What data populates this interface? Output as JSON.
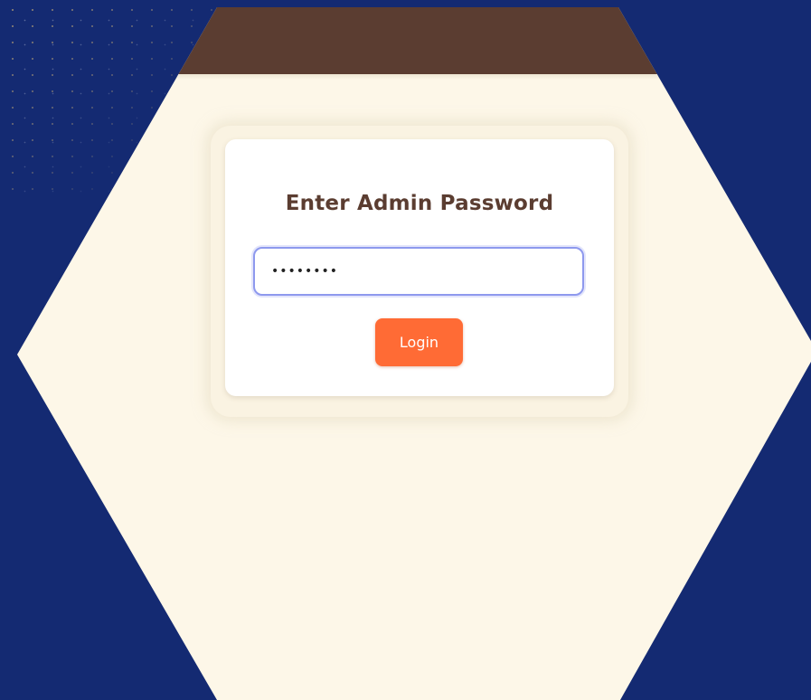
{
  "login_card": {
    "title": "Enter Admin Password",
    "password_value": "••••••••",
    "login_label": "Login"
  },
  "colors": {
    "background": "#142a72",
    "hexagon_fill": "#fdf7e8",
    "header_band": "#5b3d31",
    "title_text": "#5b3d31",
    "input_focus_border": "#8e99ee",
    "login_button": "#ff6b35"
  }
}
